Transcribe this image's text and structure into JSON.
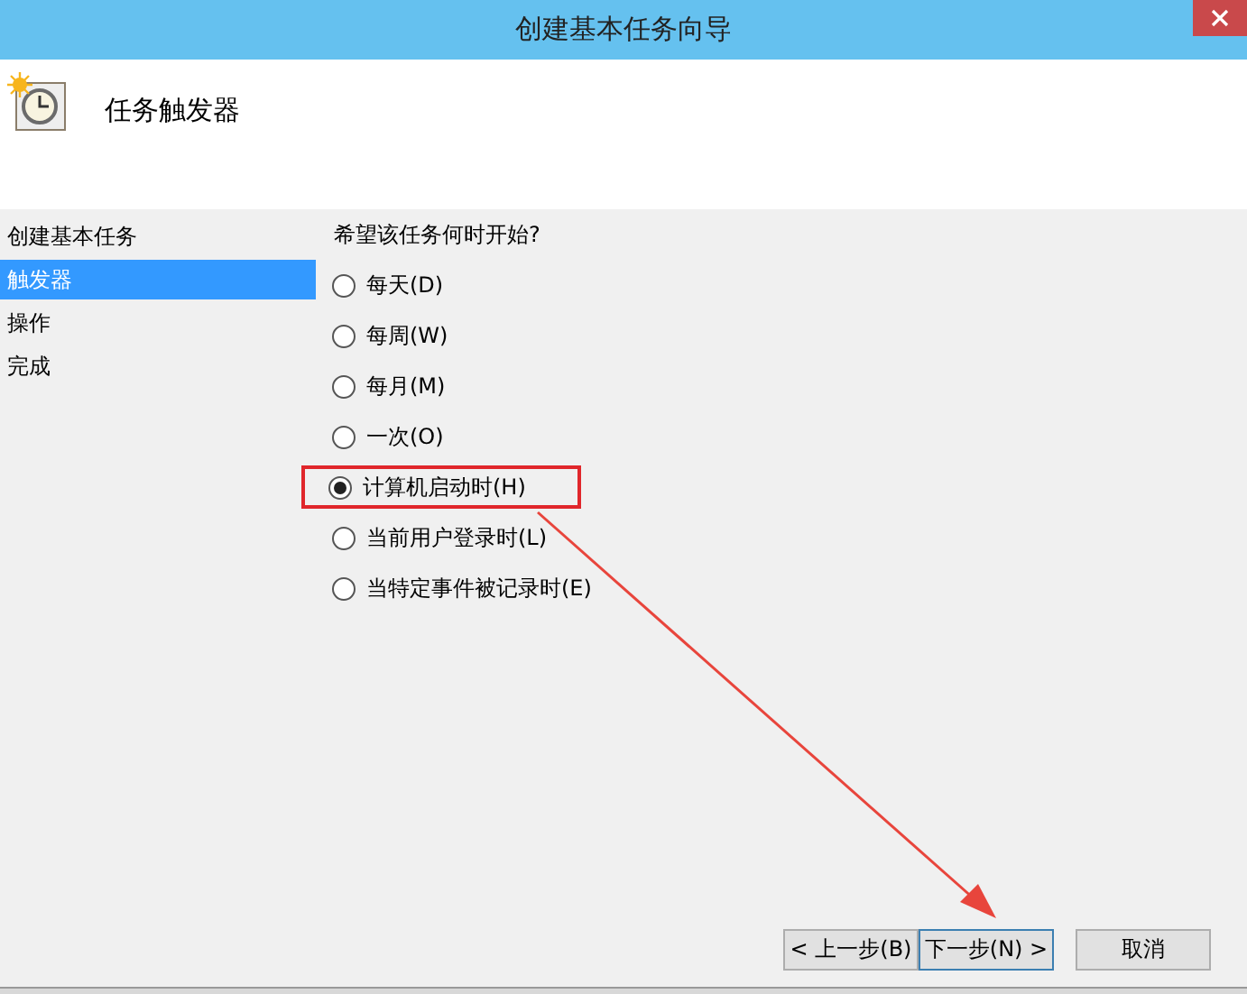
{
  "window": {
    "title": "创建基本任务向导"
  },
  "header": {
    "title": "任务触发器"
  },
  "sidebar": {
    "items": [
      {
        "label": "创建基本任务",
        "selected": false
      },
      {
        "label": "触发器",
        "selected": true
      },
      {
        "label": "操作",
        "selected": false
      },
      {
        "label": "完成",
        "selected": false
      }
    ]
  },
  "question": "希望该任务何时开始?",
  "options": [
    {
      "label": "每天(D)",
      "selected": false,
      "highlighted": false
    },
    {
      "label": "每周(W)",
      "selected": false,
      "highlighted": false
    },
    {
      "label": "每月(M)",
      "selected": false,
      "highlighted": false
    },
    {
      "label": "一次(O)",
      "selected": false,
      "highlighted": false
    },
    {
      "label": "计算机启动时(H)",
      "selected": true,
      "highlighted": true
    },
    {
      "label": "当前用户登录时(L)",
      "selected": false,
      "highlighted": false
    },
    {
      "label": "当特定事件被记录时(E)",
      "selected": false,
      "highlighted": false
    }
  ],
  "buttons": [
    {
      "label": "< 上一步(B)",
      "kind": "back"
    },
    {
      "label": "下一步(N) >",
      "kind": "next"
    },
    {
      "label": "取消",
      "kind": "cancel"
    }
  ]
}
